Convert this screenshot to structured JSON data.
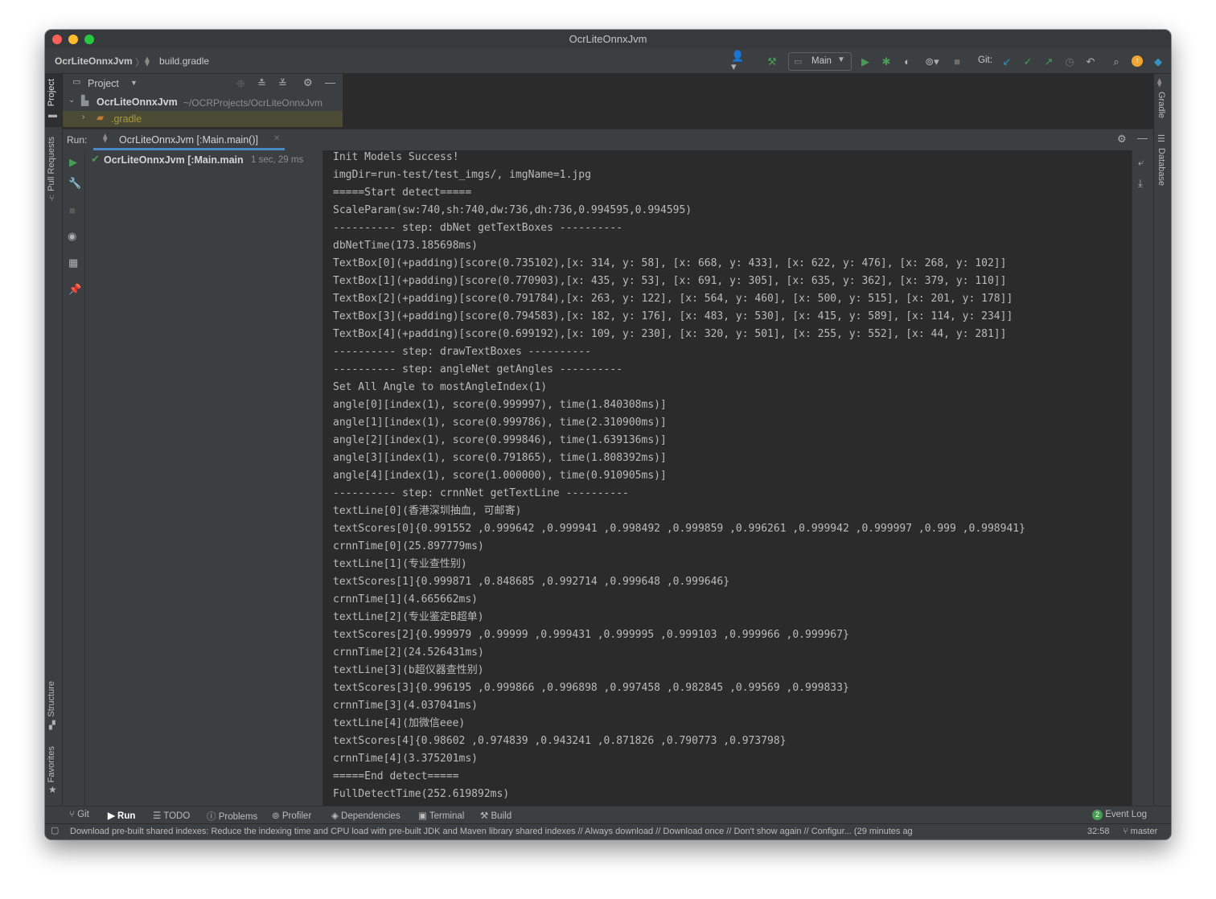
{
  "window": {
    "title": "OcrLiteOnnxJvm"
  },
  "navbar": {
    "breadcrumb_project": "OcrLiteOnnxJvm",
    "breadcrumb_file": "build.gradle",
    "run_config": "Main",
    "git_label": "Git:"
  },
  "left_tool_windows": [
    "Project",
    "Pull Requests",
    "Structure",
    "Favorites"
  ],
  "right_tool_windows": [
    "Gradle",
    "Database"
  ],
  "project_panel": {
    "title": "Project",
    "root_name": "OcrLiteOnnxJvm",
    "root_path": "~/OCRProjects/OcrLiteOnnxJvm",
    "child": ".gradle"
  },
  "run_panel": {
    "label": "Run:",
    "tab": "OcrLiteOnnxJvm [:Main.main()]",
    "tree_item": "OcrLiteOnnxJvm [:Main.main",
    "tree_time": "1 sec, 29 ms"
  },
  "console_lines": [
    "Init Models Success!",
    "imgDir=run-test/test_imgs/, imgName=1.jpg",
    "=====Start detect=====",
    "ScaleParam(sw:740,sh:740,dw:736,dh:736,0.994595,0.994595)",
    "---------- step: dbNet getTextBoxes ----------",
    "dbNetTime(173.185698ms)",
    "TextBox[0](+padding)[score(0.735102),[x: 314, y: 58], [x: 668, y: 433], [x: 622, y: 476], [x: 268, y: 102]]",
    "TextBox[1](+padding)[score(0.770903),[x: 435, y: 53], [x: 691, y: 305], [x: 635, y: 362], [x: 379, y: 110]]",
    "TextBox[2](+padding)[score(0.791784),[x: 263, y: 122], [x: 564, y: 460], [x: 500, y: 515], [x: 201, y: 178]]",
    "TextBox[3](+padding)[score(0.794583),[x: 182, y: 176], [x: 483, y: 530], [x: 415, y: 589], [x: 114, y: 234]]",
    "TextBox[4](+padding)[score(0.699192),[x: 109, y: 230], [x: 320, y: 501], [x: 255, y: 552], [x: 44, y: 281]]",
    "---------- step: drawTextBoxes ----------",
    "---------- step: angleNet getAngles ----------",
    "Set All Angle to mostAngleIndex(1)",
    "angle[0][index(1), score(0.999997), time(1.840308ms)]",
    "angle[1][index(1), score(0.999786), time(2.310900ms)]",
    "angle[2][index(1), score(0.999846), time(1.639136ms)]",
    "angle[3][index(1), score(0.791865), time(1.808392ms)]",
    "angle[4][index(1), score(1.000000), time(0.910905ms)]",
    "---------- step: crnnNet getTextLine ----------",
    "textLine[0](香港深圳抽血, 可邮寄)",
    "textScores[0]{0.991552 ,0.999642 ,0.999941 ,0.998492 ,0.999859 ,0.996261 ,0.999942 ,0.999997 ,0.999 ,0.998941}",
    "crnnTime[0](25.897779ms)",
    "textLine[1](专业查性别)",
    "textScores[1]{0.999871 ,0.848685 ,0.992714 ,0.999648 ,0.999646}",
    "crnnTime[1](4.665662ms)",
    "textLine[2](专业鉴定B超单)",
    "textScores[2]{0.999979 ,0.99999 ,0.999431 ,0.999995 ,0.999103 ,0.999966 ,0.999967}",
    "crnnTime[2](24.526431ms)",
    "textLine[3](b超仪器查性别)",
    "textScores[3]{0.996195 ,0.999866 ,0.996898 ,0.997458 ,0.982845 ,0.99569 ,0.999833}",
    "crnnTime[3](4.037041ms)",
    "textLine[4](加微信eee)",
    "textScores[4]{0.98602 ,0.974839 ,0.943241 ,0.871826 ,0.790773 ,0.973798}",
    "crnnTime[4](3.375201ms)",
    "=====End detect=====",
    "FullDetectTime(252.619892ms)"
  ],
  "bottom_tabs": [
    {
      "id": "git",
      "label": "Git",
      "icon": "git-branch-icon"
    },
    {
      "id": "run",
      "label": "Run",
      "icon": "play-icon"
    },
    {
      "id": "todo",
      "label": "TODO",
      "icon": "list-icon"
    },
    {
      "id": "problems",
      "label": "Problems",
      "icon": "info-icon"
    },
    {
      "id": "profiler",
      "label": "Profiler",
      "icon": "profiler-icon"
    },
    {
      "id": "dependencies",
      "label": "Dependencies",
      "icon": "layers-icon"
    },
    {
      "id": "terminal",
      "label": "Terminal",
      "icon": "terminal-icon"
    },
    {
      "id": "build",
      "label": "Build",
      "icon": "hammer-icon"
    }
  ],
  "event_log": {
    "count": "2",
    "label": "Event Log"
  },
  "statusbar": {
    "message": "Download pre-built shared indexes: Reduce the indexing time and CPU load with pre-built JDK and Maven library shared indexes // Always download // Download once // Don't show again // Configur... (29 minutes ag",
    "position": "32:58",
    "branch": "master"
  },
  "colors": {
    "background": "#2b2b2b",
    "panel": "#3c3f41",
    "run_green": "#499c54",
    "folder_orange": "#c07a32",
    "git_blue": "#3592c4",
    "traffic_red": "#fe5f57",
    "traffic_yellow": "#febc2e",
    "traffic_green": "#28c840"
  }
}
